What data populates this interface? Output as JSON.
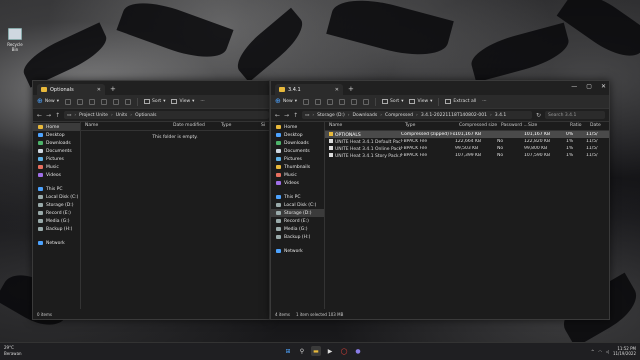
{
  "desktop": {
    "icon_label": "Recycle Bin"
  },
  "left_window": {
    "tab_title": "Optionals",
    "toolbar": {
      "new": "New",
      "sort": "Sort",
      "view": "View"
    },
    "breadcrumbs": [
      "Project Unite",
      "Units",
      "Optionals"
    ],
    "sidebar": [
      {
        "label": "Home",
        "icon_color": "#e8b93b",
        "selected": true
      },
      {
        "label": "Desktop",
        "icon_color": "#4da3ff"
      },
      {
        "label": "Downloads",
        "icon_color": "#4db36a"
      },
      {
        "label": "Documents",
        "icon_color": "#cfd7e0"
      },
      {
        "label": "Pictures",
        "icon_color": "#5fb3e8"
      },
      {
        "label": "Music",
        "icon_color": "#e86f5f"
      },
      {
        "label": "Videos",
        "icon_color": "#a06fe8"
      },
      {
        "label": "This PC",
        "icon_color": "#4da3ff"
      },
      {
        "label": "Local Disk (C:)",
        "icon_color": "#9aa"
      },
      {
        "label": "Storage (D:)",
        "icon_color": "#9aa"
      },
      {
        "label": "Record (E:)",
        "icon_color": "#9aa"
      },
      {
        "label": "Media (G:)",
        "icon_color": "#9aa"
      },
      {
        "label": "Backup (H:)",
        "icon_color": "#9aa"
      },
      {
        "label": "Network",
        "icon_color": "#4da3ff"
      }
    ],
    "columns": [
      "Name",
      "Date modified",
      "Type",
      "Si"
    ],
    "empty_message": "This folder is empty.",
    "status": "0 items"
  },
  "right_window": {
    "tab_title": "3.4.1",
    "toolbar": {
      "new": "New",
      "sort": "Sort",
      "view": "View",
      "extract": "Extract all"
    },
    "breadcrumbs": [
      "Storage (D:)",
      "Downloads",
      "Compressed",
      "3.4.1-20221118T140802-001",
      "3.4.1"
    ],
    "search_placeholder": "Search 3.4.1",
    "sidebar": [
      {
        "label": "Home",
        "icon_color": "#e8b93b"
      },
      {
        "label": "Desktop",
        "icon_color": "#4da3ff"
      },
      {
        "label": "Downloads",
        "icon_color": "#4db36a"
      },
      {
        "label": "Documents",
        "icon_color": "#cfd7e0"
      },
      {
        "label": "Pictures",
        "icon_color": "#5fb3e8"
      },
      {
        "label": "Thumbnails",
        "icon_color": "#e8b93b"
      },
      {
        "label": "Music",
        "icon_color": "#e86f5f"
      },
      {
        "label": "Videos",
        "icon_color": "#a06fe8"
      },
      {
        "label": "This PC",
        "icon_color": "#4da3ff"
      },
      {
        "label": "Local Disk (C:)",
        "icon_color": "#9aa"
      },
      {
        "label": "Storage (D:)",
        "icon_color": "#9aa",
        "selected": true
      },
      {
        "label": "Record (E:)",
        "icon_color": "#9aa"
      },
      {
        "label": "Media (G:)",
        "icon_color": "#9aa"
      },
      {
        "label": "Backup (H:)",
        "icon_color": "#9aa"
      },
      {
        "label": "Network",
        "icon_color": "#4da3ff"
      }
    ],
    "columns": [
      "Name",
      "Type",
      "Compressed size",
      "Password ...",
      "Size",
      "Ratio",
      "Date"
    ],
    "rows": [
      {
        "name": "OPTIONALS",
        "type": "Compressed (zipped) Fol...",
        "csize": "101,167 KB",
        "pw": "",
        "size": "101,167 KB",
        "ratio": "0%",
        "date": "11/5/",
        "selected": true,
        "folder": true
      },
      {
        "name": "UNITE Heat 3.4.1 Default Pack.fbpack",
        "type": "FBPACK File",
        "csize": "122,664 KB",
        "pw": "No",
        "size": "122,820 KB",
        "ratio": "1%",
        "date": "11/5/"
      },
      {
        "name": "UNITE Heat 3.4.1 Online Pack.fbpack",
        "type": "FBPACK File",
        "csize": "99,503 KB",
        "pw": "No",
        "size": "99,800 KB",
        "ratio": "1%",
        "date": "11/5/"
      },
      {
        "name": "UNITE Heat 3.4.1 Story Pack.fbpack",
        "type": "FBPACK File",
        "csize": "107,399 KB",
        "pw": "No",
        "size": "107,590 KB",
        "ratio": "1%",
        "date": "11/5/"
      }
    ],
    "status_items": "4 items",
    "status_selected": "1 item selected  103 MB"
  },
  "taskbar": {
    "weather_temp": "29°C",
    "weather_desc": "Berawan",
    "time": "11:52 PM",
    "date": "11/19/2022"
  }
}
